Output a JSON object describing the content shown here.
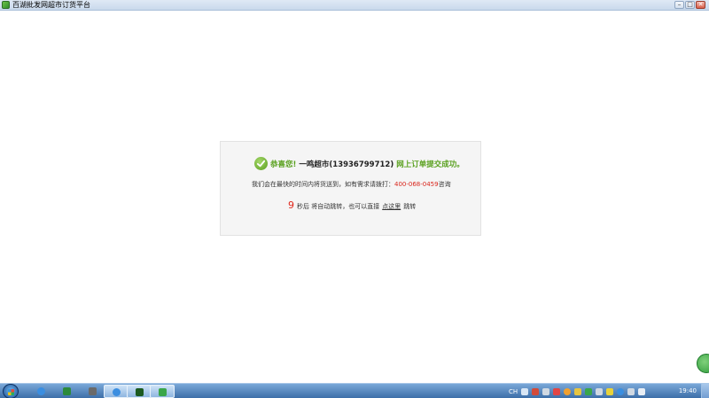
{
  "window": {
    "title": "百湖批发网超市订货平台",
    "icon": "app-icon",
    "controls": [
      {
        "name": "minimize",
        "glyph": "–"
      },
      {
        "name": "maximize",
        "glyph": "□"
      },
      {
        "name": "close",
        "glyph": "✕"
      }
    ]
  },
  "message": {
    "congrats": "恭喜您!",
    "store_name": "一鸣超市(13936799712)",
    "success_text": "网上订单提交成功。",
    "info_prefix": "我们会在最快的时间内将货送到，如有需求请拨打：",
    "phone": "400-068-0459",
    "info_suffix": "咨询",
    "countdown": "9",
    "redirect_prefix": "秒后 将自动跳转，也可以直接",
    "redirect_link": "点这里",
    "redirect_suffix": "跳转"
  },
  "taskbar": {
    "lang": "CH",
    "clock": "19:40",
    "apps": [
      {
        "name": "ie",
        "color": "#3b8ee0"
      },
      {
        "name": "excel",
        "color": "#2c8a3c"
      },
      {
        "name": "calculator",
        "color": "#6a6a6a"
      },
      {
        "name": "ie-2",
        "color": "#3b8ee0"
      },
      {
        "name": "terminal",
        "color": "#1c5a20"
      },
      {
        "name": "cart",
        "color": "#3aa64a"
      }
    ]
  },
  "colors": {
    "accent_green": "#59a01e",
    "phone_red": "#d9261c",
    "countdown_red": "#e0261a"
  }
}
